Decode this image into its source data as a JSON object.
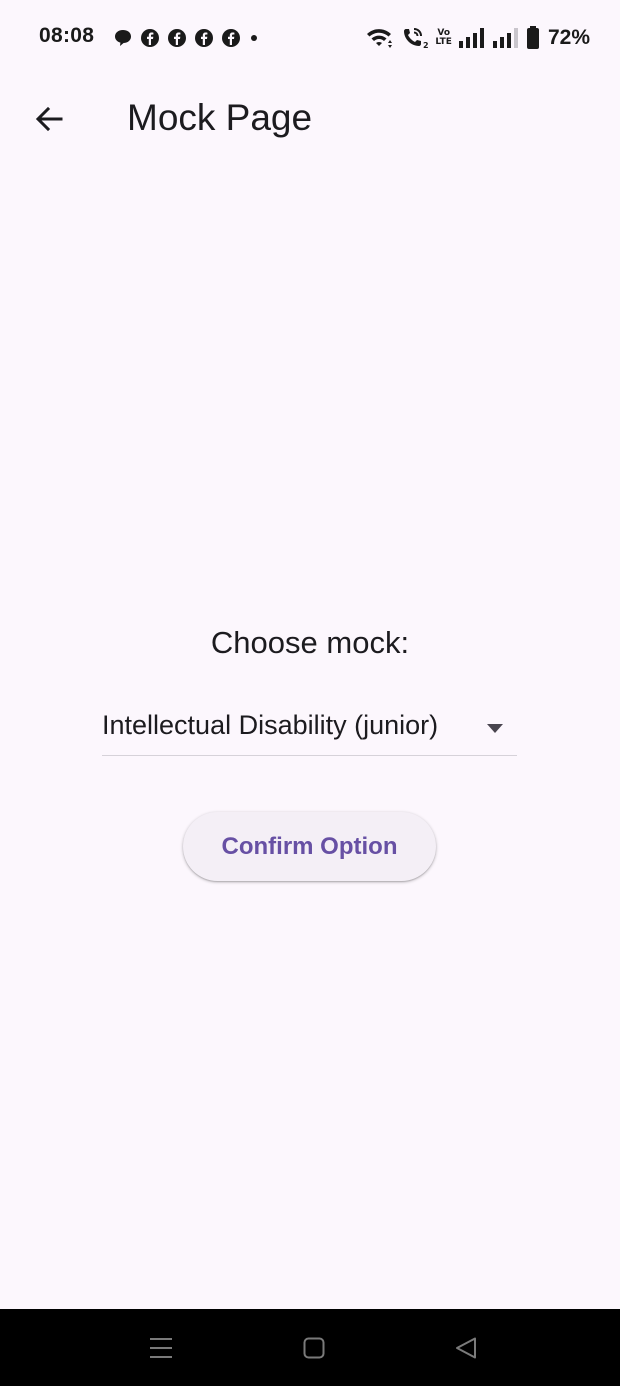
{
  "status_bar": {
    "time": "08:08",
    "notification_icons": [
      "chat-bubble-icon",
      "facebook-icon",
      "facebook-icon",
      "facebook-icon",
      "facebook-icon",
      "dot-icon"
    ],
    "volte_top": "Vo",
    "volte_bottom": "LTE",
    "battery_percent": "72%"
  },
  "app_bar": {
    "title": "Mock Page"
  },
  "main": {
    "choose_label": "Choose mock:",
    "dropdown_value": "Intellectual Disability (junior)",
    "confirm_button_label": "Confirm Option"
  },
  "colors": {
    "background": "#fcf7fd",
    "accent": "#6750a4",
    "button_surface": "#f4eff6",
    "nav_bar": "#000000"
  }
}
